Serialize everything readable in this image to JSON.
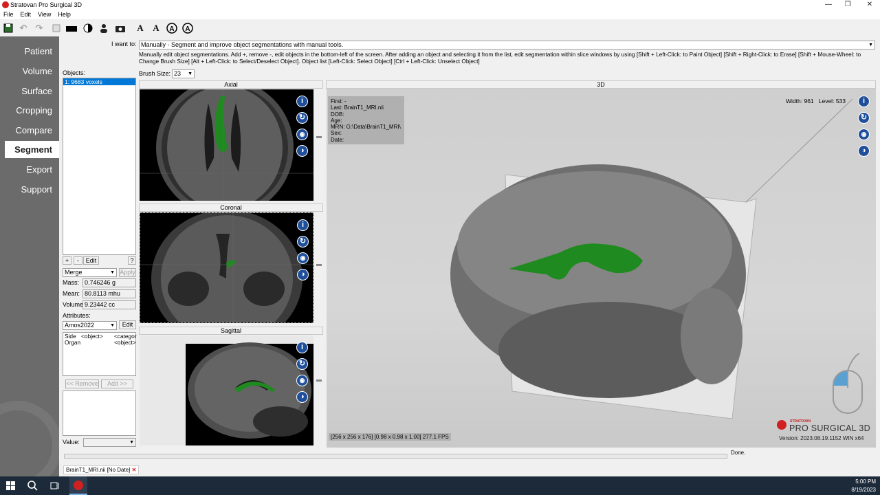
{
  "window": {
    "title": "Stratovan Pro Surgical 3D"
  },
  "menu": [
    "File",
    "Edit",
    "View",
    "Help"
  ],
  "nav": [
    "Patient",
    "Volume",
    "Surface",
    "Cropping",
    "Compare",
    "Segment",
    "Export",
    "Support"
  ],
  "nav_active": "Segment",
  "want": {
    "label": "I want to:",
    "value": "Manually   -   Segment and improve object segmentations with manual tools.",
    "description": "Manually edit object segmentations. Add +, remove -, edit objects in the bottom-left of the screen. After adding an object and selecting it from the list, edit segmentation within slice windows by using [Shift + Left-Click: to Paint Object]  [Shift + Right-Click: to Erase]  [Shift + Mouse-Wheel: to Change Brush Size]  [Alt + Left-Click: to Select/Deselect Object].  Object list [Left-Click: Select Object]   [Ctrl + Left-Click: Unselect Object]"
  },
  "brush": {
    "label": "Brush Size:",
    "value": "23"
  },
  "objects": {
    "label": "Objects:",
    "items": [
      "1: 9683 voxels"
    ],
    "add": "+",
    "remove": "-",
    "edit": "Edit",
    "help": "?",
    "mode": "Merge",
    "apply": "Apply"
  },
  "stats": {
    "mass_label": "Mass:",
    "mass": "0.746246 g",
    "mean_label": "Mean:",
    "mean": "80.8113 mhu",
    "volume_label": "Volume",
    "volume": "9.23442 cc"
  },
  "attributes": {
    "label": "Attributes:",
    "set": "Amos2022",
    "edit": "Edit",
    "rows": [
      {
        "name": "Side",
        "value": "<object>",
        "type": "<categor"
      },
      {
        "name": "Organ",
        "value": "",
        "type": "<object>"
      }
    ],
    "remove": "<< Remove",
    "add": "Add >>",
    "value_label": "Value:"
  },
  "views": {
    "axial": "Axial",
    "coronal": "Coronal",
    "sagittal": "Sagittal",
    "threed": "3D"
  },
  "overlay": {
    "first": "First: -",
    "last": "Last: BrainT1_MRI.nii",
    "dob": "DOB:",
    "age": "Age:",
    "mrn": "MRN: G:\\Data\\BrainT1_MRI\\",
    "sex": "Sex:",
    "date": "Date:",
    "width_label": "Width:",
    "width": "961",
    "level_label": "Level:",
    "level": "533",
    "status": "[256 x 256 x 176] [0.98 x 0.98 x 1.00] 277.1 FPS",
    "brand_small": "STRATOVAN",
    "brand": "PRO SURGICAL 3D",
    "version": "Version: 2023.08.19.1152 WIN x64"
  },
  "statusbar": {
    "done": "Done.",
    "file_tab": "BrainT1_MRI.nii [No Date]"
  },
  "taskbar": {
    "time": "5:00 PM",
    "date": "8/19/2023"
  },
  "colors": {
    "seg": "#1f8a1f",
    "accent": "#1f4f9a",
    "nav_bg": "#6b6b6b"
  }
}
